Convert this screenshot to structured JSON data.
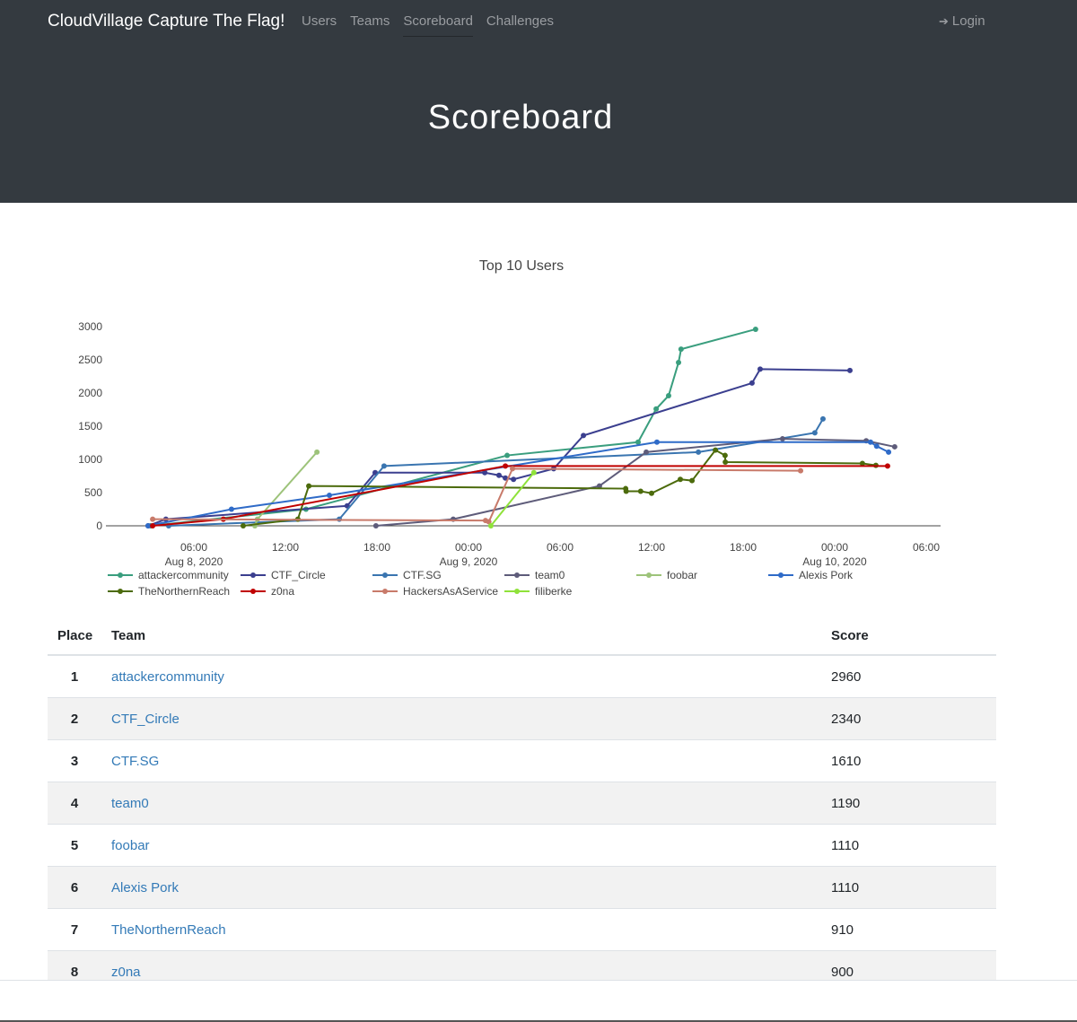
{
  "navbar": {
    "brand": "CloudVillage Capture The Flag!",
    "links": [
      "Users",
      "Teams",
      "Scoreboard",
      "Challenges"
    ],
    "active": "Scoreboard",
    "login_label": "Login",
    "login_icon": "sign-in-icon"
  },
  "hero": {
    "title": "Scoreboard"
  },
  "chart_data": {
    "type": "line",
    "title": "Top 10 Users",
    "ylim": [
      0,
      3000
    ],
    "yticks": [
      0,
      500,
      1000,
      1500,
      2000,
      2500,
      3000
    ],
    "xlim": [
      "2020-08-08T00:00",
      "2020-08-10T06:00"
    ],
    "xticks": [
      {
        "label": "06:00",
        "sub": "Aug 8, 2020",
        "t": "2020-08-08T06:00"
      },
      {
        "label": "12:00",
        "sub": "",
        "t": "2020-08-08T12:00"
      },
      {
        "label": "18:00",
        "sub": "",
        "t": "2020-08-08T18:00"
      },
      {
        "label": "00:00",
        "sub": "Aug 9, 2020",
        "t": "2020-08-09T00:00"
      },
      {
        "label": "06:00",
        "sub": "",
        "t": "2020-08-09T06:00"
      },
      {
        "label": "12:00",
        "sub": "",
        "t": "2020-08-09T12:00"
      },
      {
        "label": "18:00",
        "sub": "",
        "t": "2020-08-09T18:00"
      },
      {
        "label": "00:00",
        "sub": "Aug 10, 2020",
        "t": "2020-08-10T00:00"
      },
      {
        "label": "06:00",
        "sub": "",
        "t": "2020-08-10T06:00"
      }
    ],
    "legend_position": "bottom",
    "series": [
      {
        "name": "attackercommunity",
        "color": "#3a9e7e",
        "points": [
          [
            "2020-08-08T03:10",
            0
          ],
          [
            "2020-08-08T13:21",
            250
          ],
          [
            "2020-08-09T02:32",
            1060
          ],
          [
            "2020-08-09T11:07",
            1260
          ],
          [
            "2020-08-09T12:18",
            1760
          ],
          [
            "2020-08-09T13:07",
            1960
          ],
          [
            "2020-08-09T13:46",
            2460
          ],
          [
            "2020-08-09T13:56",
            2660
          ],
          [
            "2020-08-09T18:49",
            2960
          ]
        ]
      },
      {
        "name": "CTF_Circle",
        "color": "#3b3f8f",
        "points": [
          [
            "2020-08-08T03:00",
            0
          ],
          [
            "2020-08-08T04:10",
            100
          ],
          [
            "2020-08-08T16:03",
            300
          ],
          [
            "2020-08-08T17:53",
            800
          ],
          [
            "2020-08-09T01:04",
            800
          ],
          [
            "2020-08-09T02:00",
            760
          ],
          [
            "2020-08-09T02:25",
            720
          ],
          [
            "2020-08-09T02:57",
            700
          ],
          [
            "2020-08-09T05:35",
            860
          ],
          [
            "2020-08-09T07:32",
            1360
          ],
          [
            "2020-08-09T18:35",
            2150
          ],
          [
            "2020-08-09T19:07",
            2360
          ],
          [
            "2020-08-10T01:00",
            2340
          ]
        ]
      },
      {
        "name": "CTF.SG",
        "color": "#3a75b0",
        "points": [
          [
            "2020-08-08T04:21",
            0
          ],
          [
            "2020-08-08T15:32",
            100
          ],
          [
            "2020-08-08T18:28",
            900
          ],
          [
            "2020-08-09T15:04",
            1110
          ],
          [
            "2020-08-09T22:42",
            1400
          ],
          [
            "2020-08-09T23:14",
            1610
          ]
        ]
      },
      {
        "name": "team0",
        "color": "#5e5c7a",
        "points": [
          [
            "2020-08-08T17:56",
            0
          ],
          [
            "2020-08-08T23:00",
            100
          ],
          [
            "2020-08-09T08:35",
            600
          ],
          [
            "2020-08-09T11:39",
            1110
          ],
          [
            "2020-08-09T20:35",
            1310
          ],
          [
            "2020-08-10T02:04",
            1280
          ],
          [
            "2020-08-10T03:56",
            1190
          ]
        ]
      },
      {
        "name": "foobar",
        "color": "#9dc37a",
        "points": [
          [
            "2020-08-08T10:00",
            0
          ],
          [
            "2020-08-08T10:10",
            100
          ],
          [
            "2020-08-08T14:04",
            1110
          ]
        ]
      },
      {
        "name": "Alexis Pork",
        "color": "#2f6bc8",
        "points": [
          [
            "2020-08-08T03:00",
            0
          ],
          [
            "2020-08-08T08:28",
            250
          ],
          [
            "2020-08-08T14:53",
            460
          ],
          [
            "2020-08-09T12:21",
            1260
          ],
          [
            "2020-08-10T02:21",
            1260
          ],
          [
            "2020-08-10T02:45",
            1200
          ],
          [
            "2020-08-10T03:32",
            1110
          ]
        ]
      },
      {
        "name": "TheNorthernReach",
        "color": "#4c6b0c",
        "points": [
          [
            "2020-08-08T09:14",
            0
          ],
          [
            "2020-08-08T12:49",
            100
          ],
          [
            "2020-08-08T13:32",
            600
          ],
          [
            "2020-08-09T10:18",
            560
          ],
          [
            "2020-08-09T10:20",
            520
          ],
          [
            "2020-08-09T11:17",
            520
          ],
          [
            "2020-08-09T12:00",
            490
          ],
          [
            "2020-08-09T13:53",
            700
          ],
          [
            "2020-08-09T14:39",
            680
          ],
          [
            "2020-08-09T16:11",
            1140
          ],
          [
            "2020-08-09T16:49",
            1060
          ],
          [
            "2020-08-09T16:50",
            960
          ],
          [
            "2020-08-10T01:49",
            940
          ],
          [
            "2020-08-10T02:42",
            910
          ]
        ]
      },
      {
        "name": "z0na",
        "color": "#c00000",
        "points": [
          [
            "2020-08-08T03:18",
            0
          ],
          [
            "2020-08-08T07:56",
            100
          ],
          [
            "2020-08-09T02:25",
            900
          ],
          [
            "2020-08-10T03:28",
            900
          ]
        ]
      },
      {
        "name": "HackersAsAService",
        "color": "#c87a6a",
        "points": [
          [
            "2020-08-08T03:18",
            100
          ],
          [
            "2020-08-09T01:07",
            80
          ],
          [
            "2020-08-09T01:20",
            60
          ],
          [
            "2020-08-09T02:53",
            860
          ],
          [
            "2020-08-09T21:46",
            830
          ]
        ]
      },
      {
        "name": "filiberke",
        "color": "#8fe23a",
        "points": [
          [
            "2020-08-09T01:28",
            0
          ],
          [
            "2020-08-09T04:17",
            800
          ]
        ]
      }
    ]
  },
  "table": {
    "headers": {
      "place": "Place",
      "team": "Team",
      "score": "Score"
    },
    "rows": [
      {
        "place": "1",
        "team": "attackercommunity",
        "score": "2960"
      },
      {
        "place": "2",
        "team": "CTF_Circle",
        "score": "2340"
      },
      {
        "place": "3",
        "team": "CTF.SG",
        "score": "1610"
      },
      {
        "place": "4",
        "team": "team0",
        "score": "1190"
      },
      {
        "place": "5",
        "team": "foobar",
        "score": "1110"
      },
      {
        "place": "6",
        "team": "Alexis Pork",
        "score": "1110"
      },
      {
        "place": "7",
        "team": "TheNorthernReach",
        "score": "910"
      },
      {
        "place": "8",
        "team": "z0na",
        "score": "900"
      }
    ]
  }
}
